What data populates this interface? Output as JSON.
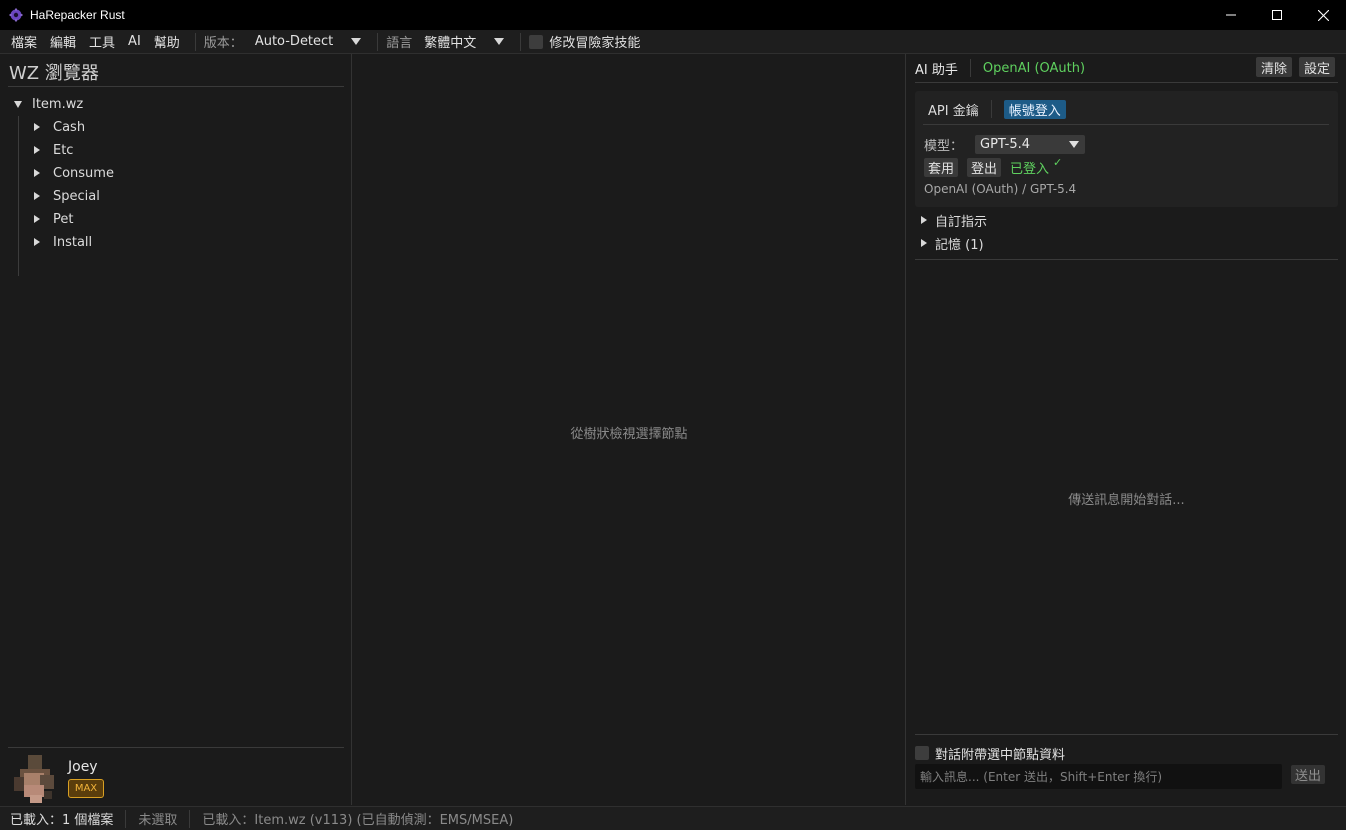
{
  "window": {
    "title": "HaRepacker Rust",
    "icon": "gear-logo-icon"
  },
  "menubar": {
    "items": [
      "檔案",
      "編輯",
      "工具",
      "AI",
      "幫助"
    ],
    "version_label": "版本：",
    "version_value": "Auto-Detect",
    "language_label": "語言",
    "language_value": "繁體中文",
    "modify_skill_label": "修改冒險家技能"
  },
  "left_panel": {
    "title": "WZ 瀏覽器",
    "tree_root": "Item.wz",
    "tree_children": [
      "Cash",
      "Etc",
      "Consume",
      "Special",
      "Pet",
      "Install"
    ],
    "user_name": "Joey",
    "user_badge": "MAX"
  },
  "center_panel": {
    "hint": "從樹狀檢視選擇節點"
  },
  "right_panel": {
    "title": "AI 助手",
    "provider": "OpenAI (OAuth)",
    "clear_label": "清除",
    "settings_label": "設定",
    "auth_tabs": [
      "API 金鑰",
      "帳號登入"
    ],
    "active_auth_tab": "帳號登入",
    "model_label": "模型：",
    "model_value": "GPT-5.4",
    "apply_label": "套用",
    "logout_label": "登出",
    "logged_in_label": "已登入",
    "provider_summary": "OpenAI (OAuth) / GPT-5.4",
    "custom_instructions_label": "自訂指示",
    "memory_label": "記憶 (1)",
    "chat_hint": "傳送訊息開始對話...",
    "attach_label": "對話附帶選中節點資料",
    "input_placeholder": "輸入訊息... (Enter 送出，Shift+Enter 換行)",
    "send_label": "送出"
  },
  "statusbar": {
    "loaded_count": "已載入：1 個檔案",
    "selection": "未選取",
    "loaded_detail": "已載入：Item.wz (v113) (已自動偵測：EMS/MSEA)"
  },
  "colors": {
    "background": "#1b1b1b",
    "accent_green": "#5fd15f",
    "accent_blue": "#1d5b87",
    "badge_gold": "#f2b43a"
  }
}
